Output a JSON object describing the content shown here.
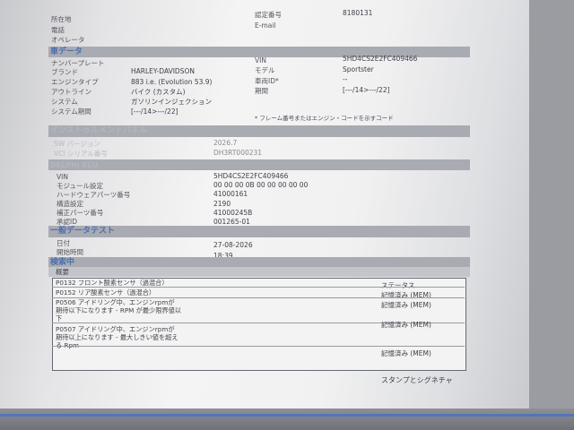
{
  "header": {
    "location_label": "所在地",
    "phone_label": "電話",
    "operator_label": "オペレータ",
    "cert_label": "認定番号",
    "cert_value": "8180131",
    "email_label": "E-mail"
  },
  "vehicle": {
    "section_title": "車データ",
    "plate_label": "ナンバープレート",
    "brand_label": "ブランド",
    "brand_value": "HARLEY-DAVIDSON",
    "engine_label": "エンジンタイプ",
    "engine_value": "883 i.e. (Evolution 53.9)",
    "outline_label": "アウトライン",
    "outline_value": "バイク (カスタム)",
    "system_label": "システム",
    "system_value": "ガソリンインジェクション",
    "system_period_label": "システム期間",
    "system_period_value": "[---/14>---/22]",
    "vin_label": "VIN",
    "vin_value": "5HD4CS2E2FC409466",
    "model_label": "モデル",
    "model_value": "Sportster",
    "vehicle_id_label": "車両ID*",
    "vehicle_id_value": "--",
    "period_label": "期間",
    "period_value": "[---/14>---/22]",
    "footnote": "* フレーム番号またはエンジン・コードを示すコード"
  },
  "instrument": {
    "section_title": "インストゥルメントパネル",
    "sw_label": "SW バージョン",
    "sw_value": "2026.7",
    "serial_label": "VCI シリアル番号",
    "serial_value": "DH3RT000231"
  },
  "ecu": {
    "section_title": "DELPHI ECU",
    "vin_label": "VIN",
    "vin_value": "5HD4CS2E2FC409466",
    "module_label": "モジュール設定",
    "module_value": "00 00 00 0B 00 00 00 00 00",
    "hw_label": "ハードウェアパーツ番号",
    "hw_value": "41000161",
    "calib_label": "構造設定",
    "calib_value": "2190",
    "cal_part_label": "補正パーツ番号",
    "cal_part_value": "41000245B",
    "supplier_label": "承認ID",
    "supplier_value": "001265-01"
  },
  "test": {
    "section_title": "一般データテスト",
    "date_label": "日付",
    "date_value": "27-08-2026",
    "time_label": "開始時間",
    "time_value": "18:39"
  },
  "results": {
    "section_title": "検索中",
    "col_summary": "概要",
    "col_status": "ステータス",
    "rows": [
      {
        "lines": [
          "P0132 フロント酸素センサ（過混合）"
        ],
        "status": ""
      },
      {
        "lines": [
          "P0152 リア酸素センサ（過混合）"
        ],
        "status": "記憶済み (MEM)"
      },
      {
        "lines": [
          "P0506 アイドリング中、エンジンrpmが",
          "期待以下になります - RPM が最少限界値以",
          "下"
        ],
        "status": "記憶済み (MEM)"
      },
      {
        "lines": [
          "P0507 アイドリング中、エンジンrpmが",
          "期待以上になります - 最大しきい値を超え",
          "る Rpm"
        ],
        "status": "記憶済み (MEM)"
      },
      {
        "lines": [
          ""
        ],
        "status": "記憶済み (MEM)"
      }
    ],
    "stamp_label": "スタンプとシグネチャ"
  }
}
